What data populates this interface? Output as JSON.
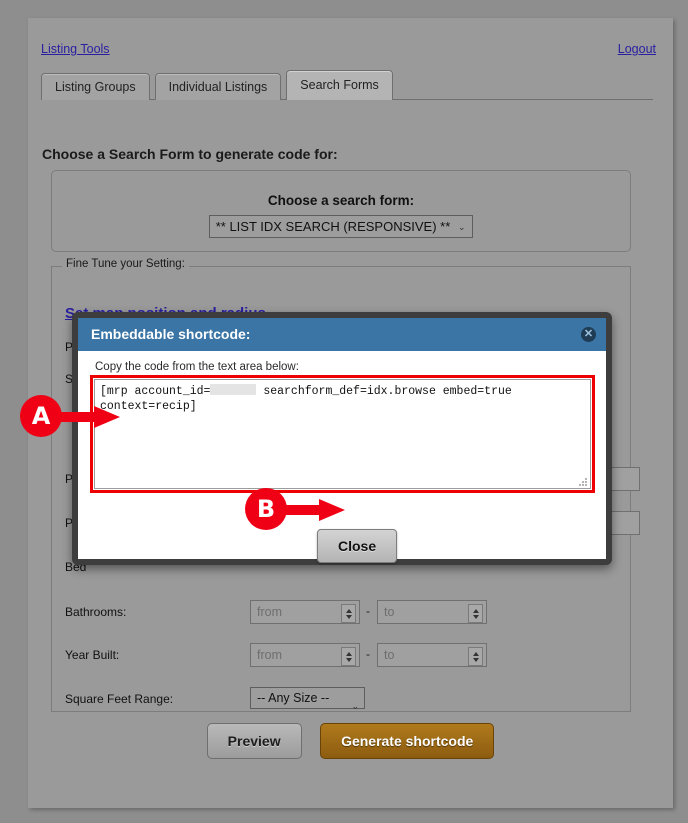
{
  "header": {
    "listing_tools_link": "Listing Tools",
    "logout_link": "Logout"
  },
  "tabs": [
    {
      "label": "Listing Groups",
      "active": false
    },
    {
      "label": "Individual Listings",
      "active": false
    },
    {
      "label": "Search Forms",
      "active": true
    }
  ],
  "main": {
    "section_heading": "Choose a Search Form to generate code for:",
    "choose_form": {
      "label": "Choose a search form:",
      "selected": "** LIST IDX SEARCH (RESPONSIVE) **",
      "chevron": "⌄"
    },
    "fine_tune": {
      "legend": "Fine Tune your Setting:",
      "map_link": "Set map position and radius",
      "hidden_rows": [
        {
          "label": "Posi"
        },
        {
          "label": "Sa"
        },
        {
          "label": "Pric"
        },
        {
          "label": "Prop"
        },
        {
          "label": "Bed"
        }
      ],
      "rows": [
        {
          "label": "Bathrooms:",
          "from_placeholder": "from",
          "to_placeholder": "to",
          "separator": "-"
        },
        {
          "label": "Year Built:",
          "from_placeholder": "from",
          "to_placeholder": "to",
          "separator": "-"
        }
      ],
      "square_feet": {
        "label": "Square Feet Range:",
        "selected": "-- Any Size --",
        "chevron": "⌄"
      }
    },
    "buttons": {
      "preview": "Preview",
      "generate": "Generate shortcode"
    }
  },
  "modal": {
    "title": "Embeddable shortcode:",
    "close_x": "✕",
    "instruction": "Copy the code from the text area below:",
    "code_part1": "[mrp account_id=",
    "code_part2": "searchform_def=idx.browse embed=true context=recip]",
    "close_button": "Close"
  },
  "annotations": [
    {
      "id": "A",
      "letter": "A"
    },
    {
      "id": "B",
      "letter": "B"
    }
  ],
  "colors": {
    "page_bg": "#8e8e8e",
    "panel_bg": "#9a9a9a",
    "modal_header": "#3a75a6",
    "link": "#2a1fa0",
    "generate_button": "#8c5c10",
    "annotation_red": "#f00015",
    "highlight_outline": "#ee0000"
  }
}
